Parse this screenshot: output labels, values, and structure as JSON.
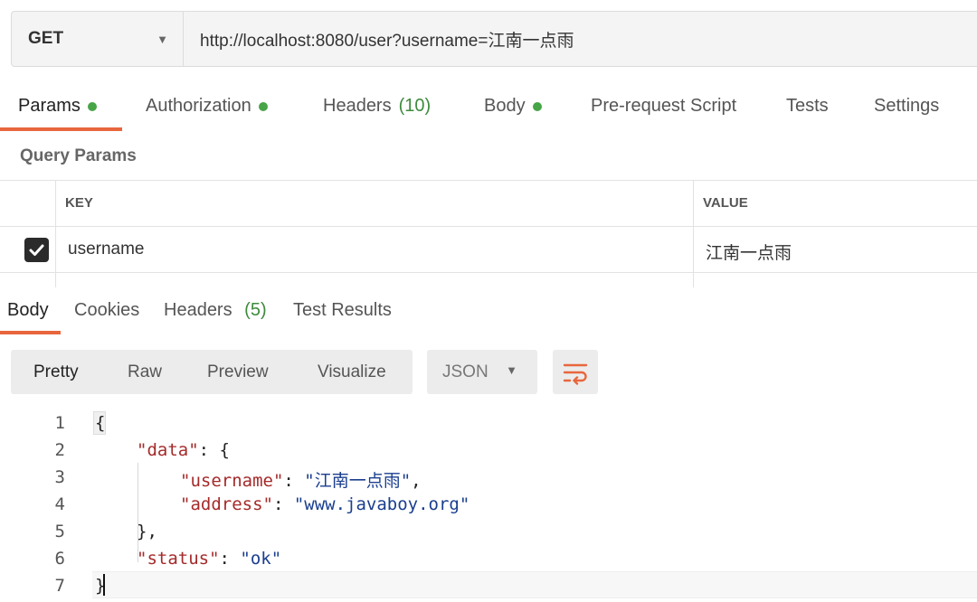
{
  "request": {
    "method": "GET",
    "url": "http://localhost:8080/user?username=江南一点雨"
  },
  "request_tabs": [
    {
      "label": "Params",
      "dot": true
    },
    {
      "label": "Authorization",
      "dot": true
    },
    {
      "label": "Headers",
      "count": "(10)"
    },
    {
      "label": "Body",
      "dot": true
    },
    {
      "label": "Pre-request Script"
    },
    {
      "label": "Tests"
    },
    {
      "label": "Settings"
    }
  ],
  "query_params": {
    "title": "Query Params",
    "columns": {
      "key": "KEY",
      "value": "VALUE"
    },
    "rows": [
      {
        "checked": true,
        "key": "username",
        "value": "江南一点雨"
      }
    ]
  },
  "response_tabs": [
    {
      "label": "Body"
    },
    {
      "label": "Cookies"
    },
    {
      "label": "Headers",
      "count": "(5)"
    },
    {
      "label": "Test Results"
    }
  ],
  "view_modes": [
    "Pretty",
    "Raw",
    "Preview",
    "Visualize"
  ],
  "format": "JSON",
  "code_lines": {
    "n": [
      "1",
      "2",
      "3",
      "4",
      "5",
      "6",
      "7"
    ],
    "l1": "{",
    "k_data": "\"data\"",
    "open_brace": ": {",
    "k_username": "\"username\"",
    "v_username": "\"江南一点雨\"",
    "k_address": "\"address\"",
    "v_address": "\"www.javaboy.org\"",
    "close_brace": "},",
    "k_status": "\"status\"",
    "v_status": "\"ok\"",
    "l7": "}",
    "colon": ": ",
    "comma": ","
  },
  "colors": {
    "accent": "#e8663d",
    "dot_green": "#47a447",
    "json_key": "#a52a2a",
    "json_string": "#1a3e8f"
  }
}
